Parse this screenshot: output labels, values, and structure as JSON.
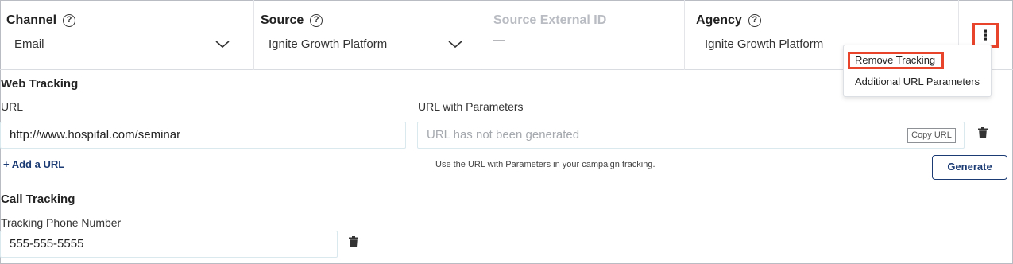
{
  "header": {
    "channel": {
      "label": "Channel",
      "value": "Email"
    },
    "source": {
      "label": "Source",
      "value": "Ignite Growth Platform"
    },
    "source_external_id": {
      "label": "Source External ID",
      "value": "—"
    },
    "agency": {
      "label": "Agency",
      "value": "Ignite Growth Platform"
    },
    "help_glyph": "?",
    "more_glyph": "⋮"
  },
  "menu": {
    "items": [
      "Remove Tracking",
      "Additional URL Parameters"
    ]
  },
  "web_tracking": {
    "title": "Web Tracking",
    "url_label": "URL",
    "url_value": "http://www.hospital.com/seminar",
    "params_label": "URL with Parameters",
    "params_placeholder": "URL has not been generated",
    "copy_label": "Copy URL",
    "add_url": "+ Add a URL",
    "hint": "Use the URL with Parameters in your campaign tracking.",
    "generate_label": "Generate"
  },
  "call_tracking": {
    "title": "Call Tracking",
    "phone_label": "Tracking Phone Number",
    "phone_value": "555-555-5555"
  },
  "icons": {
    "help": "help-circle-icon",
    "chevron": "chevron-down-icon",
    "more": "kebab-menu-icon",
    "delete": "trash-icon"
  },
  "colors": {
    "accent": "#1b3b74",
    "highlight": "#e8442c",
    "border": "#d9e9ee"
  }
}
